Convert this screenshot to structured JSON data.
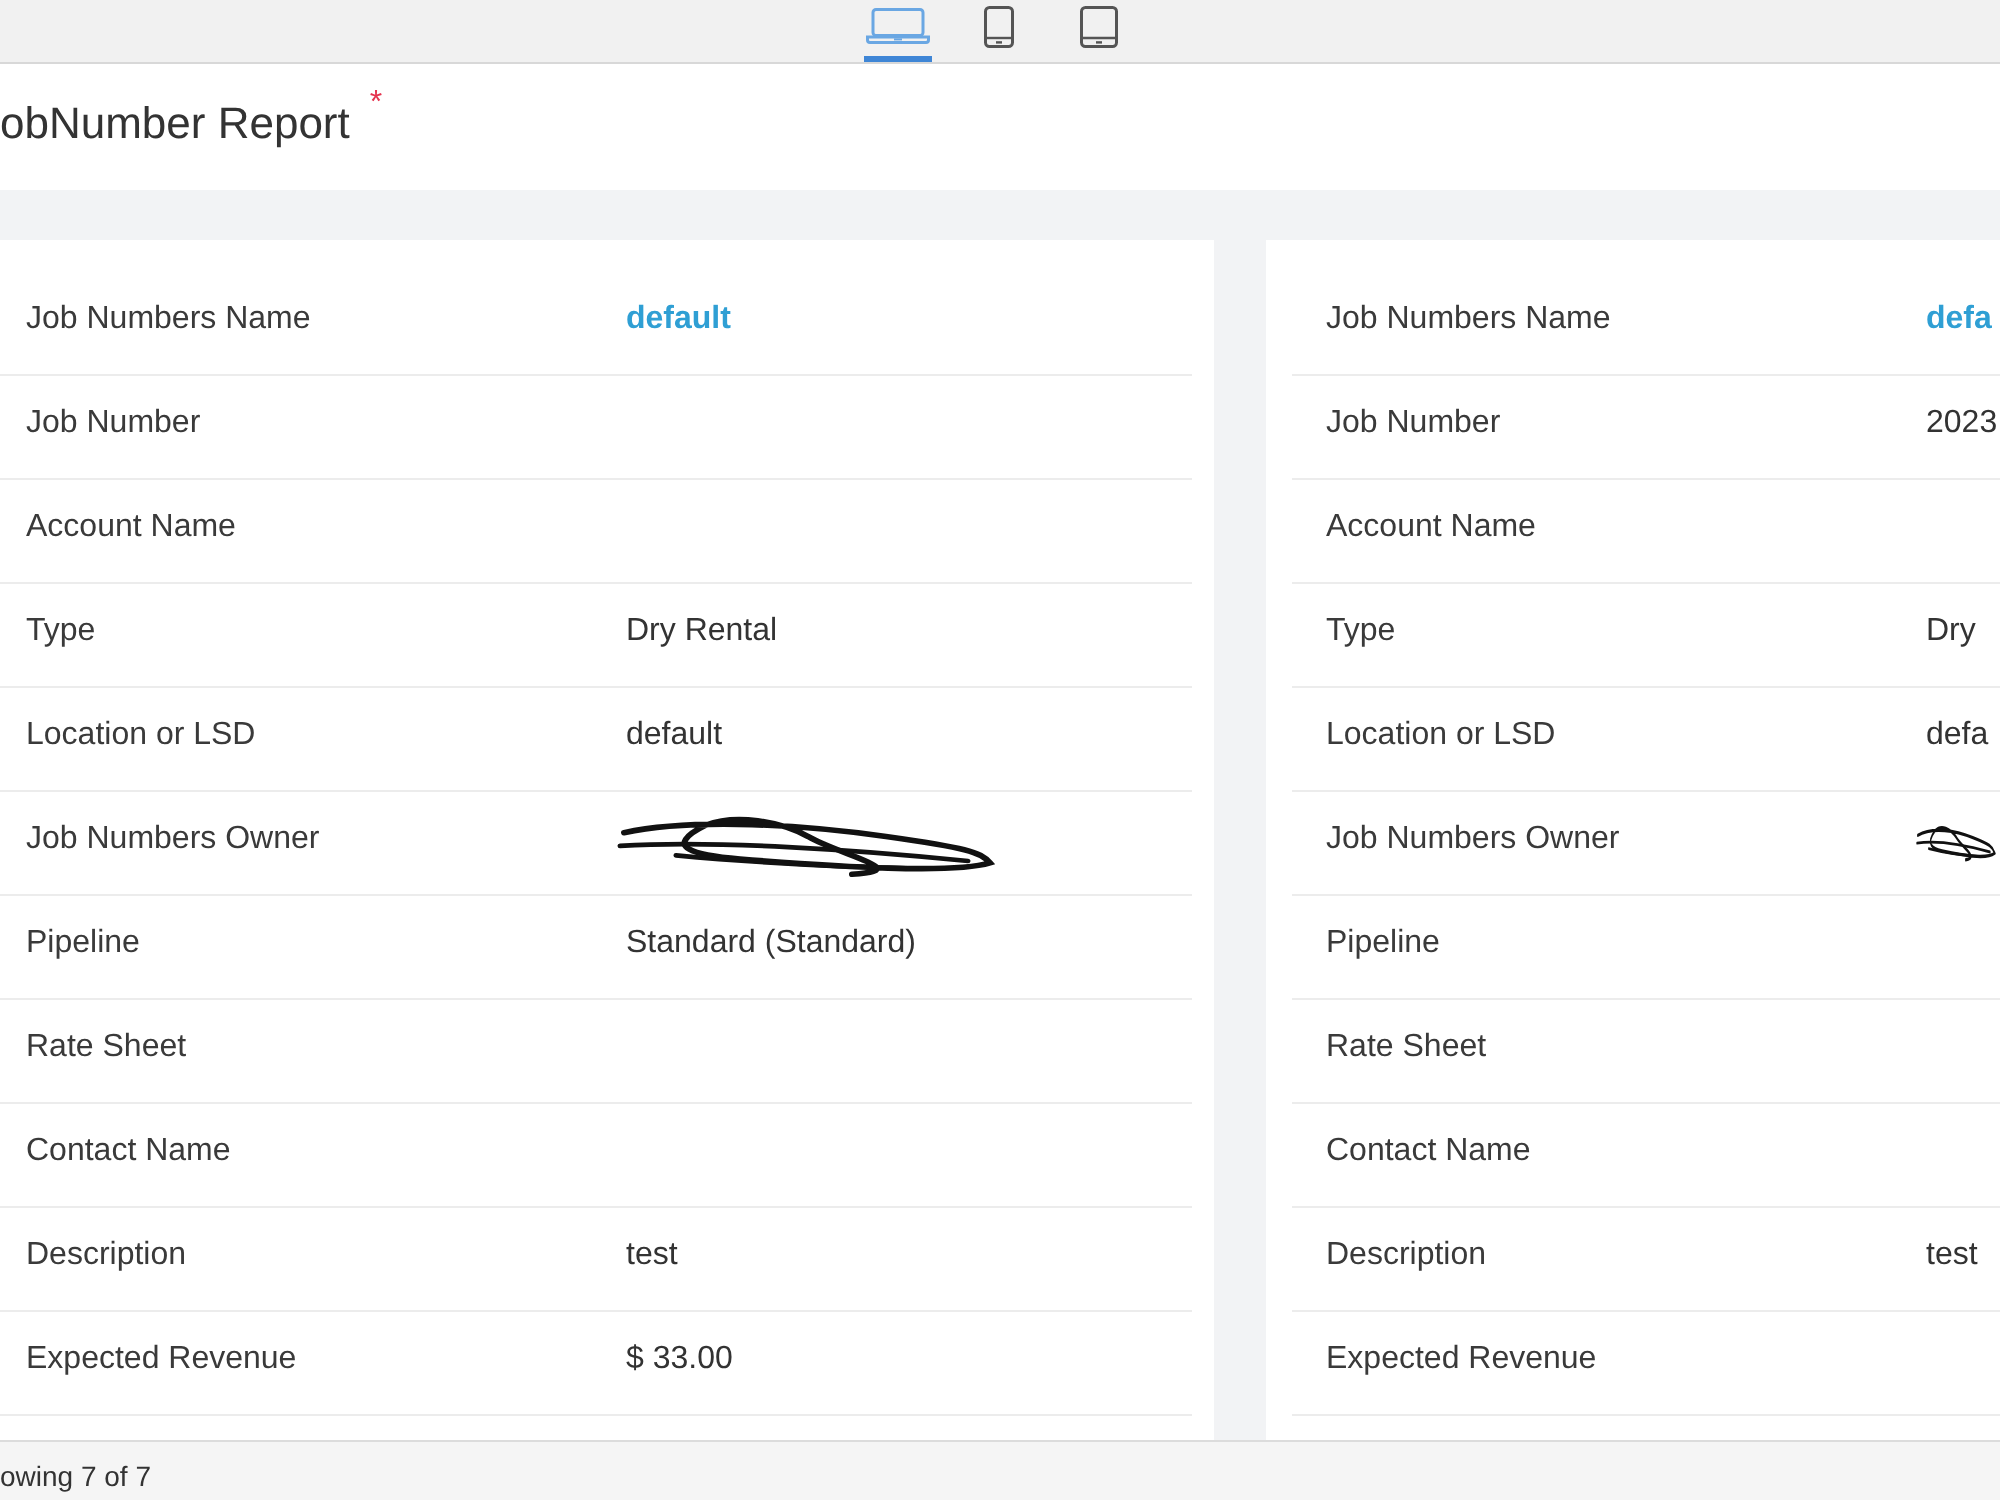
{
  "device_views": [
    {
      "kind": "laptop",
      "selected": true
    },
    {
      "kind": "phone",
      "selected": false
    },
    {
      "kind": "tablet",
      "selected": false
    }
  ],
  "header": {
    "title": "obNumber Report",
    "required_mark": "*"
  },
  "records": [
    {
      "fields": [
        {
          "label": "Job Numbers Name",
          "value": "default",
          "kind": "link"
        },
        {
          "label": "Job Number",
          "kind": "text"
        },
        {
          "label": "Account Name",
          "kind": "text"
        },
        {
          "label": "Type",
          "value": "Dry Rental",
          "kind": "text"
        },
        {
          "label": "Location or LSD",
          "value": "default",
          "kind": "text"
        },
        {
          "label": "Job Numbers Owner",
          "kind": "redacted"
        },
        {
          "label": "Pipeline",
          "value": "Standard (Standard)",
          "kind": "text"
        },
        {
          "label": "Rate Sheet",
          "kind": "text"
        },
        {
          "label": "Contact Name",
          "kind": "text"
        },
        {
          "label": "Description",
          "value": "test",
          "kind": "text"
        },
        {
          "label": "Expected Revenue",
          "value": "$ 33.00",
          "kind": "text"
        }
      ]
    },
    {
      "fields": [
        {
          "label": "Job Numbers Name",
          "value": "defa",
          "kind": "link"
        },
        {
          "label": "Job Number",
          "value": "2023",
          "kind": "text"
        },
        {
          "label": "Account Name",
          "kind": "text"
        },
        {
          "label": "Type",
          "value": "Dry",
          "kind": "text"
        },
        {
          "label": "Location or LSD",
          "value": "defa",
          "kind": "text"
        },
        {
          "label": "Job Numbers Owner",
          "kind": "redacted"
        },
        {
          "label": "Pipeline",
          "kind": "text"
        },
        {
          "label": "Rate Sheet",
          "kind": "text"
        },
        {
          "label": "Contact Name",
          "kind": "text"
        },
        {
          "label": "Description",
          "value": "test",
          "kind": "text"
        },
        {
          "label": "Expected Revenue",
          "kind": "text"
        }
      ]
    }
  ],
  "footer": {
    "status": "owing 7 of 7"
  }
}
